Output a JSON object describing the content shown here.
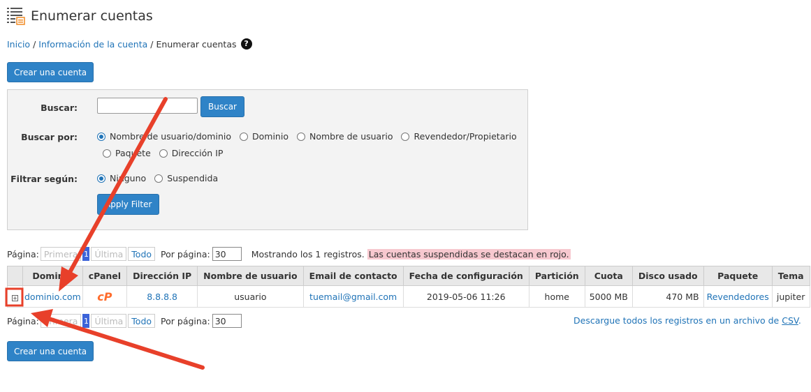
{
  "page": {
    "title": "Enumerar cuentas",
    "help_glyph": "?"
  },
  "breadcrumb": {
    "home": "Inicio",
    "sep1": "/",
    "account_info": "Información de la cuenta",
    "sep2": "/",
    "current": "Enumerar cuentas"
  },
  "create_button": "Crear una cuenta",
  "search": {
    "label": "Buscar:",
    "button": "Buscar",
    "value": "",
    "by_label": "Buscar por:",
    "by_options": [
      "Nombre de usuario/dominio",
      "Dominio",
      "Nombre de usuario",
      "Revendedor/Propietario",
      "Paquete",
      "Dirección IP"
    ],
    "by_selected": "Nombre de usuario/dominio",
    "filter_label": "Filtrar según:",
    "filter_options": [
      "Ninguno",
      "Suspendida"
    ],
    "filter_selected": "Ninguno",
    "apply_button": "Apply Filter"
  },
  "pager": {
    "label": "Página:",
    "first": "Primera",
    "current": "1",
    "last": "Última",
    "all": "Todo",
    "per_page_label": "Por página:",
    "per_page": "30",
    "showing": "Mostrando los 1 registros.",
    "suspended_note": "Las cuentas suspendidas se destacan en rojo."
  },
  "table": {
    "headers": [
      "Dominio",
      "cPanel",
      "Dirección IP",
      "Nombre de usuario",
      "Email de contacto",
      "Fecha de configuración",
      "Partición",
      "Cuota",
      "Disco usado",
      "Paquete",
      "Tema"
    ],
    "rows": [
      {
        "expand": "+",
        "domain": "dominio.com",
        "cpanel": "cP",
        "ip": "8.8.8.8",
        "user": "usuario",
        "email": "tuemail@gmail.com",
        "date": "2019-05-06 11:26",
        "partition": "home",
        "quota": "5000 MB",
        "disk": "470 MB",
        "package": "Revendedores",
        "theme": "jupiter"
      }
    ]
  },
  "csv": {
    "text": "Descargue todos los registros en un archivo de",
    "link": "CSV",
    "period": "."
  },
  "colors": {
    "accent": "#2f83c7",
    "link": "#1f73b7",
    "arrow": "#e8402a",
    "suspended_bg": "#f7c8cf",
    "cpanel_orange": "#ff6c2c"
  }
}
